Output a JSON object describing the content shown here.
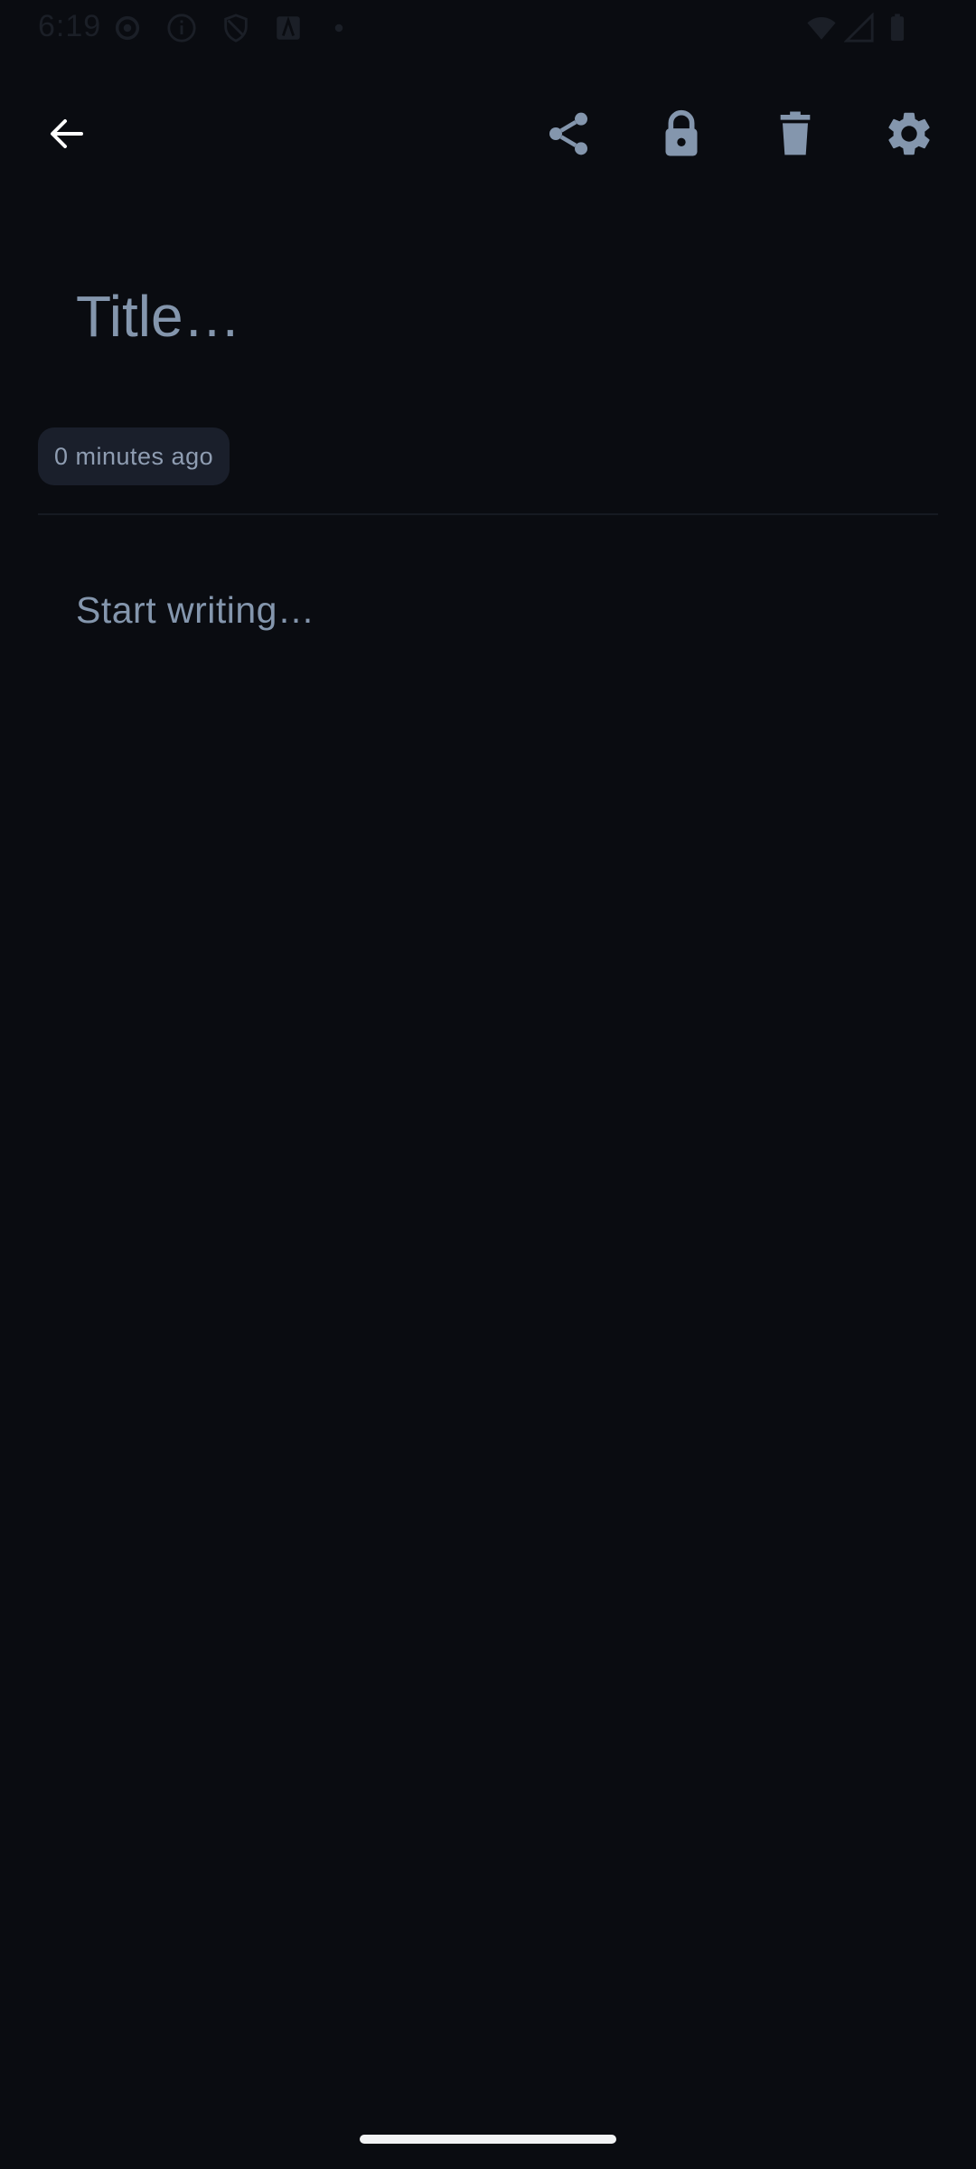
{
  "status_bar": {
    "time": "6:19",
    "icons": [
      "settings-icon",
      "info-icon",
      "shield-icon",
      "font-icon",
      "dot-icon",
      "wifi-icon",
      "signal-icon",
      "battery-icon"
    ]
  },
  "toolbar": {
    "icons": [
      "back-arrow-icon",
      "share-icon",
      "lock-icon",
      "trash-icon",
      "settings-gear-icon"
    ],
    "icon_color": "#8496ad",
    "back_color": "#ffffff"
  },
  "note": {
    "title_placeholder": "Title…",
    "timestamp": "0 minutes ago",
    "body_placeholder": "Start writing…"
  },
  "colors": {
    "background": "#0a0c11",
    "chip_background": "#1a1f2b",
    "text_muted": "#8496ad"
  }
}
